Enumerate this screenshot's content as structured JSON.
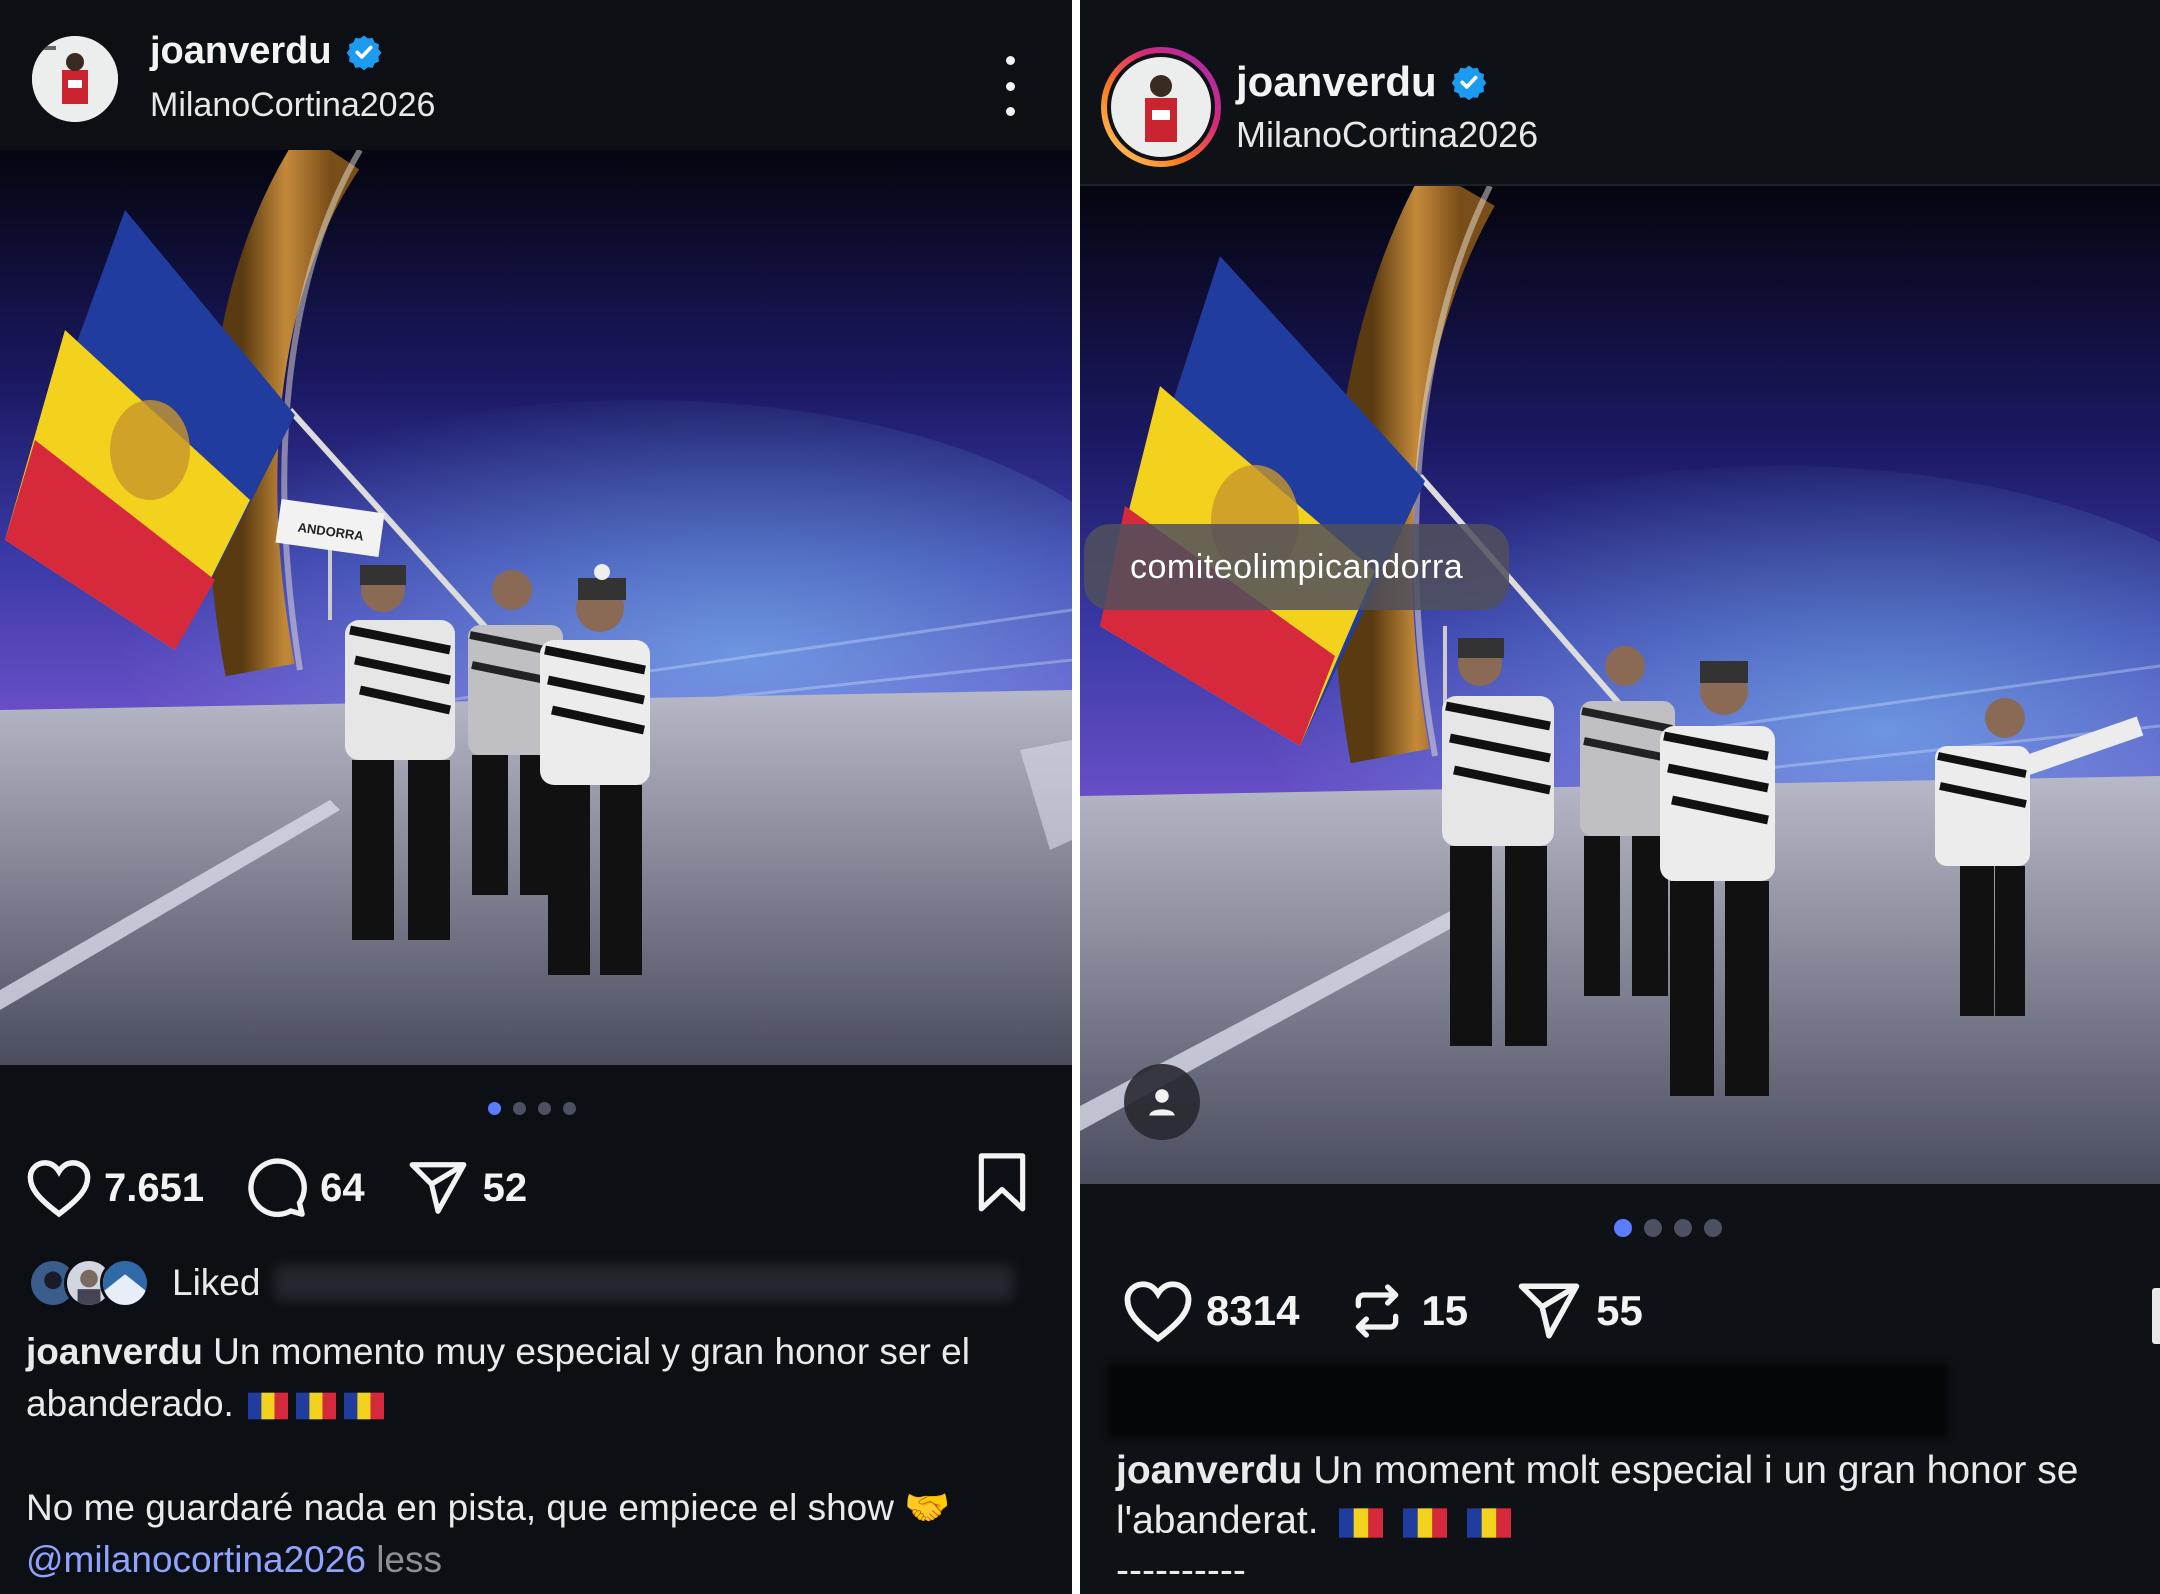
{
  "left": {
    "username": "joanverdu",
    "location": "MilanoCortina2026",
    "photo_sign": "ANDORRA",
    "carousel": {
      "count": 4,
      "active": 0
    },
    "likes": "7.651",
    "comments": "64",
    "shares": "52",
    "liked_label": "Liked",
    "caption_user": "joanverdu",
    "caption_text": "Un momento muy especial y gran honor ser el abanderado.",
    "caption_line2": "No me guardaré nada en pista, que empiece el show",
    "caption_emoji": "🤝",
    "mention": "@milanocortina2026",
    "less": "less"
  },
  "right": {
    "username": "joanverdu",
    "location": "MilanoCortina2026",
    "tag": "comiteolimpicandorra",
    "carousel": {
      "count": 4,
      "active": 0
    },
    "likes": "8314",
    "reposts": "15",
    "shares": "55",
    "caption_user": "joanverdu",
    "caption_text": "Un moment molt especial i un gran honor se",
    "caption_line2": "l'abanderat.",
    "caption_line3": "----------"
  },
  "colors": {
    "accent_blue": "#5b7cff",
    "verified_blue": "#1d9bf0",
    "background": "#0c0f14"
  },
  "icons": [
    "verified-badge-icon",
    "more-icon",
    "heart-icon",
    "comment-icon",
    "share-icon",
    "bookmark-icon",
    "repost-icon",
    "user-tag-icon"
  ]
}
